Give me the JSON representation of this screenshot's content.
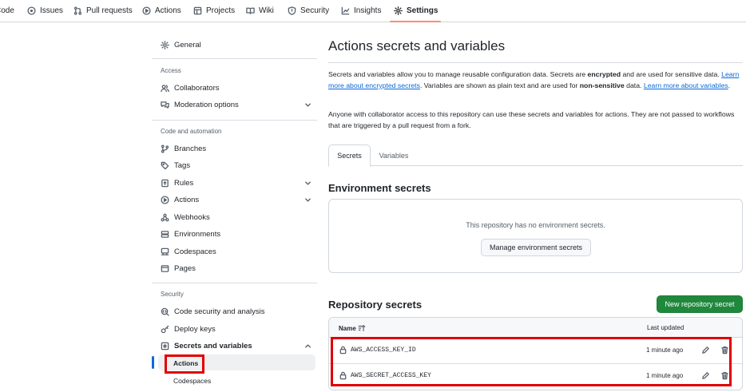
{
  "repo_nav": {
    "tabs": [
      {
        "label": "Code",
        "icon": "code-icon"
      },
      {
        "label": "Issues",
        "icon": "issue-icon"
      },
      {
        "label": "Pull requests",
        "icon": "pull-request-icon"
      },
      {
        "label": "Actions",
        "icon": "play-icon"
      },
      {
        "label": "Projects",
        "icon": "table-icon"
      },
      {
        "label": "Wiki",
        "icon": "book-icon"
      },
      {
        "label": "Security",
        "icon": "shield-icon"
      },
      {
        "label": "Insights",
        "icon": "graph-icon"
      },
      {
        "label": "Settings",
        "icon": "gear-icon"
      }
    ]
  },
  "sidebar": {
    "general": "General",
    "access_heading": "Access",
    "collaborators": "Collaborators",
    "moderation": "Moderation options",
    "code_heading": "Code and automation",
    "branches": "Branches",
    "tags": "Tags",
    "rules": "Rules",
    "actions": "Actions",
    "webhooks": "Webhooks",
    "environments": "Environments",
    "codespaces": "Codespaces",
    "pages": "Pages",
    "security_heading": "Security",
    "code_security": "Code security and analysis",
    "deploy_keys": "Deploy keys",
    "secrets_vars": "Secrets and variables",
    "sub_actions": "Actions",
    "sub_codespaces": "Codespaces"
  },
  "main": {
    "title": "Actions secrets and variables",
    "desc_1": "Secrets and variables allow you to manage reusable configuration data. Secrets are ",
    "desc_encrypted": "encrypted",
    "desc_2": " and are used for sensitive data. ",
    "desc_link1": "Learn more about encrypted secrets",
    "desc_3": ". Variables are shown as plain text and are used for ",
    "desc_nonsensitive": "non-sensitive",
    "desc_4": " data. ",
    "desc_link2": "Learn more about variables",
    "desc_5": ".",
    "notice": "Anyone with collaborator access to this repository can use these secrets and variables for actions. They are not passed to workflows that are triggered by a pull request from a fork.",
    "tabs": [
      "Secrets",
      "Variables"
    ],
    "env_title": "Environment secrets",
    "env_empty": "This repository has no environment secrets.",
    "env_button": "Manage environment secrets",
    "repo_title": "Repository secrets",
    "new_secret_button": "New repository secret",
    "table": {
      "col_name": "Name",
      "col_updated": "Last updated",
      "rows": [
        {
          "name": "AWS_ACCESS_KEY_ID",
          "updated": "1 minute ago"
        },
        {
          "name": "AWS_SECRET_ACCESS_KEY",
          "updated": "1 minute ago"
        }
      ]
    }
  },
  "colors": {
    "accent": "#0969da",
    "active_underline": "#fd8c73",
    "primary_button": "#1f883d",
    "annotation": "#e00000"
  }
}
